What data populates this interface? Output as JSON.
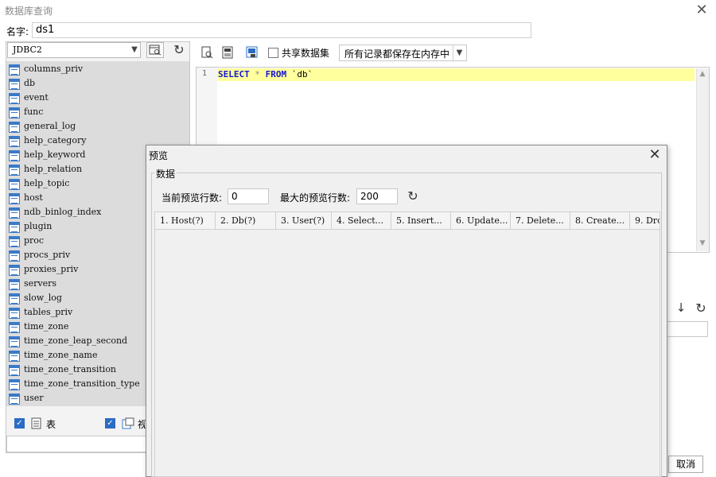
{
  "window": {
    "title": "数据库查询",
    "close_glyph": "✕"
  },
  "name_field": {
    "label": "名字:",
    "value": "ds1"
  },
  "connection": {
    "selected": "JDBC2"
  },
  "tables": [
    "columns_priv",
    "db",
    "event",
    "func",
    "general_log",
    "help_category",
    "help_keyword",
    "help_relation",
    "help_topic",
    "host",
    "ndb_binlog_index",
    "plugin",
    "proc",
    "procs_priv",
    "proxies_priv",
    "servers",
    "slow_log",
    "tables_priv",
    "time_zone",
    "time_zone_leap_second",
    "time_zone_name",
    "time_zone_transition",
    "time_zone_transition_type",
    "user"
  ],
  "filters": {
    "table_label": "表",
    "view_label": "视",
    "table_checked": true,
    "view_checked": true
  },
  "toolbar": {
    "shared_label": "共享数据集",
    "shared_checked": false,
    "memory_option": "所有记录都保存在内存中"
  },
  "editor": {
    "line_number": "1",
    "sql": {
      "select": "SELECT",
      "star": "*",
      "from": "FROM",
      "table": "`db`"
    },
    "highlight_color": "#ffff9e",
    "keyword_color": "#1616d6"
  },
  "footer": {
    "cancel_label": "取消"
  },
  "preview_dialog": {
    "title": "预览",
    "group_label": "数据",
    "current_rows_label": "当前预览行数:",
    "current_rows_value": "0",
    "max_rows_label": "最大的预览行数:",
    "max_rows_value": "200",
    "columns": [
      "1. Host(?)",
      "2. Db(?)",
      "3. User(?)",
      "4. Select...",
      "5. Insert...",
      "6. Update...",
      "7. Delete...",
      "8. Create...",
      "9. Dro"
    ]
  },
  "colors": {
    "accent": "#2b6cc4",
    "table_icon": "#3a7ac8",
    "list_bg": "#dcdcdc"
  }
}
